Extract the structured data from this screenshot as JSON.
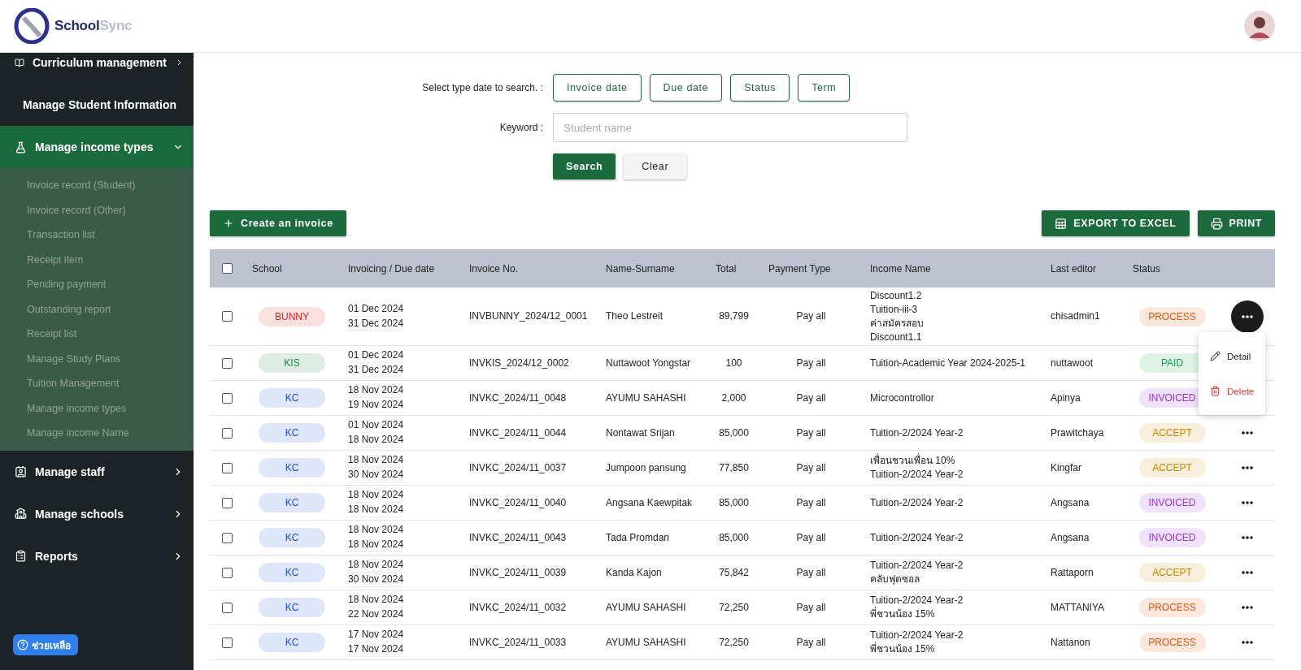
{
  "header": {
    "logo": {
      "brand_part1": "School",
      "brand_part2": "Sync"
    }
  },
  "sidebar": {
    "items": [
      {
        "label": "Curriculum management",
        "expanded": false
      },
      {
        "label": "Manage Student Information",
        "expanded": false
      },
      {
        "label": "Manage income types",
        "expanded": true,
        "children": [
          {
            "label": "Invoice record (Student)"
          },
          {
            "label": "Invoice record (Other)"
          },
          {
            "label": "Transaction list"
          },
          {
            "label": "Receipt item"
          },
          {
            "label": "Pending payment"
          },
          {
            "label": "Outstanding report"
          },
          {
            "label": "Receipt list"
          },
          {
            "label": "Manage Study Plans"
          },
          {
            "label": "Tuition Management"
          },
          {
            "label": "Manage income types"
          },
          {
            "label": "Manage income Name"
          }
        ]
      },
      {
        "label": "Manage staff",
        "expanded": false
      },
      {
        "label": "Manage schools",
        "expanded": false
      },
      {
        "label": "Reports",
        "expanded": false
      }
    ],
    "help_button": "ช่วยเหลือ"
  },
  "search": {
    "type_label": "Select type date to search. :",
    "type_buttons": [
      "Invoice date",
      "Due date",
      "Status",
      "Term"
    ],
    "keyword_label": "Keyword :",
    "keyword_placeholder": "Student name",
    "search_button": "Search",
    "clear_button": "Clear"
  },
  "toolbar": {
    "create_button": "Create an invoice",
    "export_button": "EXPORT TO EXCEL",
    "print_button": "PRINT"
  },
  "table": {
    "header_checked": false,
    "columns": [
      "School",
      "Invoicing / Due date",
      "Invoice No.",
      "Name-Surname",
      "Total",
      "Payment Type",
      "Income Name",
      "Last editor",
      "Status"
    ],
    "rows": [
      {
        "checked": false,
        "school": {
          "label": "BUNNY",
          "color": "#e02424"
        },
        "dates": [
          "01 Dec 2024",
          "31 Dec 2024"
        ],
        "invoice": "INVBUNNY_2024/12_0001",
        "name": "Theo Lestreit",
        "total": "89,799",
        "payment": "Pay all",
        "income": [
          "Discount1.2",
          "Tuition-iii-3",
          "ค่าสมัครสอบ",
          "Discount1.1"
        ],
        "editor": "chisadmin1",
        "status": {
          "label": "PROCESS",
          "color": "#ea580c"
        },
        "menu_open": true
      },
      {
        "checked": false,
        "school": {
          "label": "KIS",
          "color": "#15803d"
        },
        "dates": [
          "01 Dec 2024",
          "31 Dec 2024"
        ],
        "invoice": "INVKIS_2024/12_0002",
        "name": "Nuttawoot Yongstar",
        "total": "100",
        "payment": "Pay all",
        "income": [
          "Tuition-Academic Year 2024-2025-1"
        ],
        "editor": "nuttawoot",
        "status": {
          "label": "PAID",
          "color": "#16a34a"
        }
      },
      {
        "checked": false,
        "school": {
          "label": "KC",
          "color": "#1d4ed8"
        },
        "dates": [
          "18 Nov 2024",
          "19 Nov 2024"
        ],
        "invoice": "INVKC_2024/11_0048",
        "name": "AYUMU SAHASHI",
        "total": "2,000",
        "payment": "Pay all",
        "income": [
          "Microcontrollor"
        ],
        "editor": "Apinya",
        "status": {
          "label": "INVOICED",
          "color": "#9333ea"
        }
      },
      {
        "checked": false,
        "school": {
          "label": "KC",
          "color": "#1d4ed8"
        },
        "dates": [
          "01 Nov 2024",
          "18 Nov 2024"
        ],
        "invoice": "INVKC_2024/11_0044",
        "name": "Nontawat Srijan",
        "total": "85,000",
        "payment": "Pay all",
        "income": [
          "Tuition-2/2024 Year-2"
        ],
        "editor": "Prawitchaya",
        "status": {
          "label": "ACCEPT",
          "color": "#ca8a04"
        },
        "menu_open": false
      },
      {
        "checked": false,
        "school": {
          "label": "KC",
          "color": "#1d4ed8"
        },
        "dates": [
          "18 Nov 2024",
          "30 Nov 2024"
        ],
        "invoice": "INVKC_2024/11_0037",
        "name": "Jumpoon pansung",
        "total": "77,850",
        "payment": "Pay all",
        "income": [
          "เพื่อนชวนเพื่อน 10%",
          "Tuition-2/2024 Year-2"
        ],
        "editor": "Kingfar",
        "status": {
          "label": "ACCEPT",
          "color": "#ca8a04"
        },
        "menu_open": false
      },
      {
        "checked": false,
        "school": {
          "label": "KC",
          "color": "#1d4ed8"
        },
        "dates": [
          "18 Nov 2024",
          "18 Nov 2024"
        ],
        "invoice": "INVKC_2024/11_0040",
        "name": "Angsana Kaewpitak",
        "total": "85,000",
        "payment": "Pay all",
        "income": [
          "Tuition-2/2024 Year-2"
        ],
        "editor": "Angsana",
        "status": {
          "label": "INVOICED",
          "color": "#9333ea"
        },
        "menu_open": false
      },
      {
        "checked": false,
        "school": {
          "label": "KC",
          "color": "#1d4ed8"
        },
        "dates": [
          "18 Nov 2024",
          "18 Nov 2024"
        ],
        "invoice": "INVKC_2024/11_0043",
        "name": "Tada Promdan",
        "total": "85,000",
        "payment": "Pay all",
        "income": [
          "Tuition-2/2024 Year-2"
        ],
        "editor": "Angsana",
        "status": {
          "label": "INVOICED",
          "color": "#9333ea"
        },
        "menu_open": false
      },
      {
        "checked": false,
        "school": {
          "label": "KC",
          "color": "#1d4ed8"
        },
        "dates": [
          "18 Nov 2024",
          "30 Nov 2024"
        ],
        "invoice": "INVKC_2024/11_0039",
        "name": "Kanda Kajon",
        "total": "75,842",
        "payment": "Pay all",
        "income": [
          "Tuition-2/2024 Year-2",
          "คลับฟุตซอล"
        ],
        "editor": "Rattaporn",
        "status": {
          "label": "ACCEPT",
          "color": "#ca8a04"
        },
        "menu_open": false
      },
      {
        "checked": false,
        "school": {
          "label": "KC",
          "color": "#1d4ed8"
        },
        "dates": [
          "18 Nov 2024",
          "22 Nov 2024"
        ],
        "invoice": "INVKC_2024/11_0032",
        "name": "AYUMU SAHASHI",
        "total": "72,250",
        "payment": "Pay all",
        "income": [
          "Tuition-2/2024 Year-2",
          "พี่ชวนน้อง 15%"
        ],
        "editor": "MATTANIYA",
        "status": {
          "label": "PROCESS",
          "color": "#ea580c"
        },
        "menu_open": false
      },
      {
        "checked": false,
        "school": {
          "label": "KC",
          "color": "#1d4ed8"
        },
        "dates": [
          "17 Nov 2024",
          "17 Nov 2024"
        ],
        "invoice": "INVKC_2024/11_0033",
        "name": "AYUMU SAHASHI",
        "total": "72,250",
        "payment": "Pay all",
        "income": [
          "Tuition-2/2024 Year-2",
          "พี่ชวนน้อง 15%"
        ],
        "editor": "Nattanon",
        "status": {
          "label": "PROCESS",
          "color": "#ea580c"
        },
        "menu_open": false
      }
    ]
  },
  "row_menu": {
    "items": [
      {
        "label": "Detail",
        "kind": "edit"
      },
      {
        "label": "Delete",
        "kind": "delete"
      }
    ]
  }
}
